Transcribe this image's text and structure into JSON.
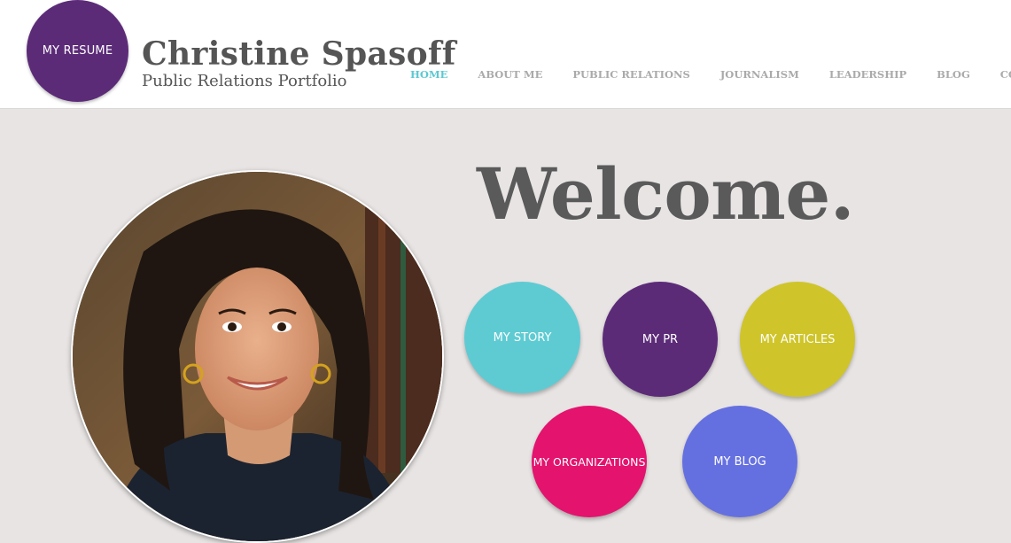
{
  "header": {
    "resume_label": "MY RESUME",
    "name": "Christine Spasoff",
    "subtitle": "Public Relations Portfolio",
    "nav": [
      {
        "label": "HOME",
        "active": true
      },
      {
        "label": "ABOUT ME"
      },
      {
        "label": "PUBLIC RELATIONS"
      },
      {
        "label": "JOURNALISM"
      },
      {
        "label": "LEADERSHIP"
      },
      {
        "label": "BLOG"
      },
      {
        "label": "CONTACT"
      }
    ]
  },
  "main": {
    "welcome": "Welcome.",
    "bubbles": [
      {
        "label": "MY STORY",
        "color": "#5ecbd3"
      },
      {
        "label": "MY PR",
        "color": "#5c2b78"
      },
      {
        "label": "MY ARTICLES",
        "color": "#cfc52a"
      },
      {
        "label": "MY ORGANIZATIONS",
        "color": "#e4136e"
      },
      {
        "label": "MY BLOG",
        "color": "#6570e0"
      }
    ]
  },
  "colors": {
    "resume_circle": "#5c2b78",
    "nav_active": "#5bc8d1",
    "nav_inactive": "#aaaaaa",
    "page_bg": "#e8e4e4"
  }
}
